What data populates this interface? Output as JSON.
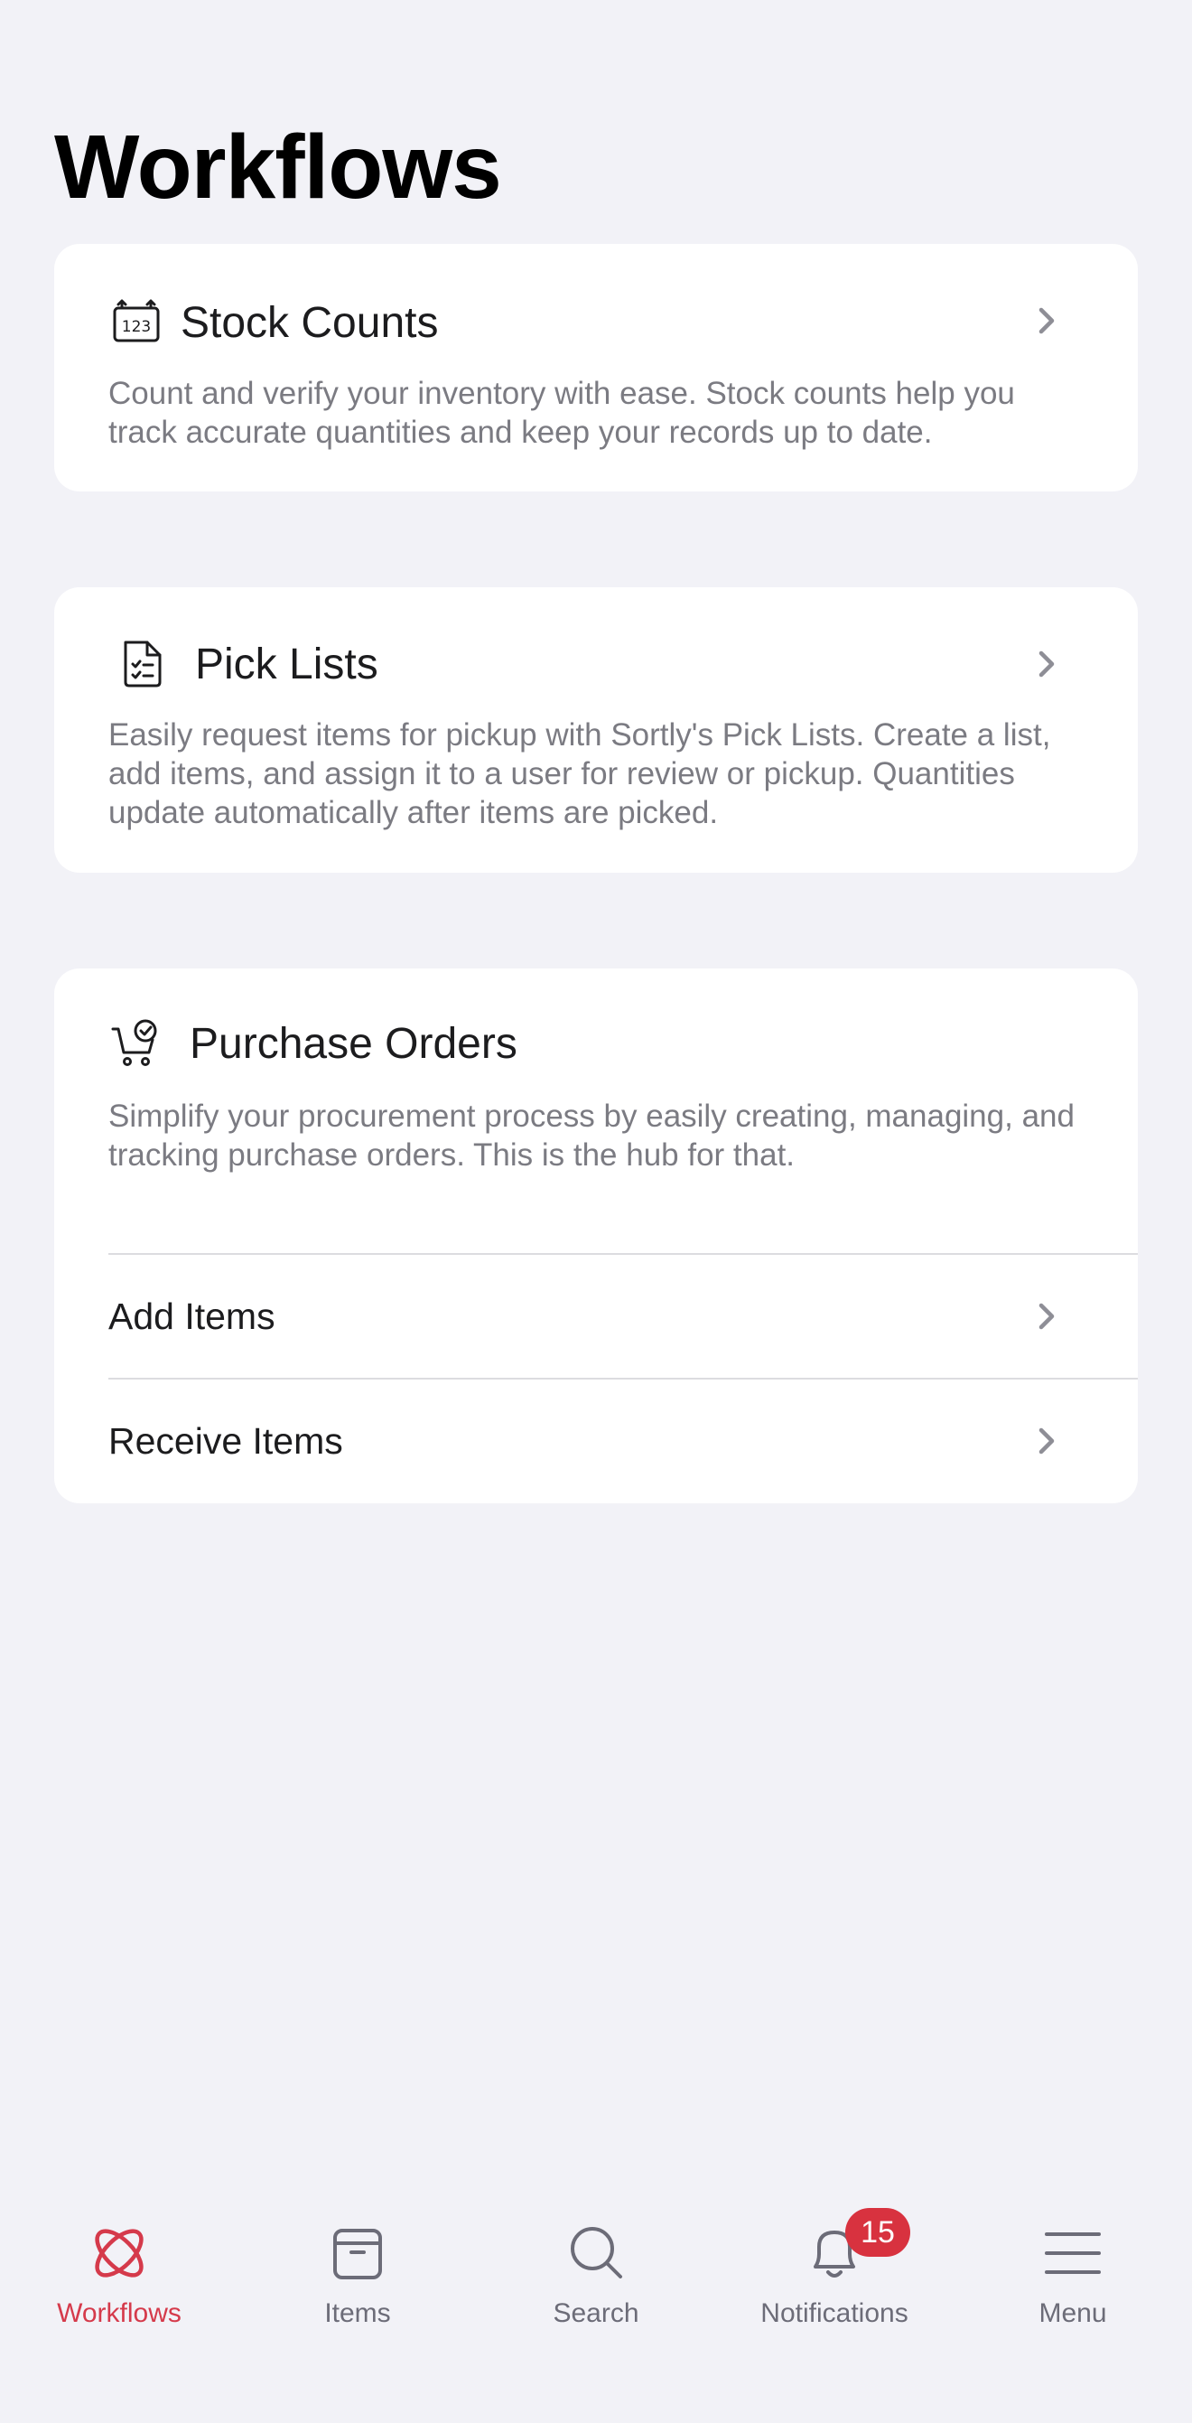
{
  "page": {
    "title": "Workflows"
  },
  "cards": {
    "stock_counts": {
      "icon": "counter-123-icon",
      "title": "Stock Counts",
      "description": "Count and verify your inventory with ease. Stock counts help you track accurate quantities and keep your records up to date."
    },
    "pick_lists": {
      "icon": "checklist-document-icon",
      "title": "Pick Lists",
      "description": "Easily request items for pickup with Sortly's Pick Lists. Create a list, add items, and assign it to a user for review or pickup. Quantities update automatically after items are picked."
    },
    "purchase_orders": {
      "icon": "cart-check-icon",
      "title": "Purchase Orders",
      "description": "Simplify your procurement process by easily creating, managing, and tracking purchase orders. This is the hub for that.",
      "rows": [
        {
          "label": "Add Items"
        },
        {
          "label": "Receive Items"
        }
      ]
    }
  },
  "tabbar": {
    "tabs": [
      {
        "label": "Workflows",
        "icon": "workflows-icon",
        "active": true
      },
      {
        "label": "Items",
        "icon": "box-icon"
      },
      {
        "label": "Search",
        "icon": "search-icon"
      },
      {
        "label": "Notifications",
        "icon": "bell-icon",
        "badge": "15"
      },
      {
        "label": "Menu",
        "icon": "menu-icon"
      }
    ]
  },
  "colors": {
    "background": "#f2f2f7",
    "card": "#ffffff",
    "accent": "#d53a4b",
    "badge": "#d8323f",
    "secondary_text": "#7b7b82"
  }
}
